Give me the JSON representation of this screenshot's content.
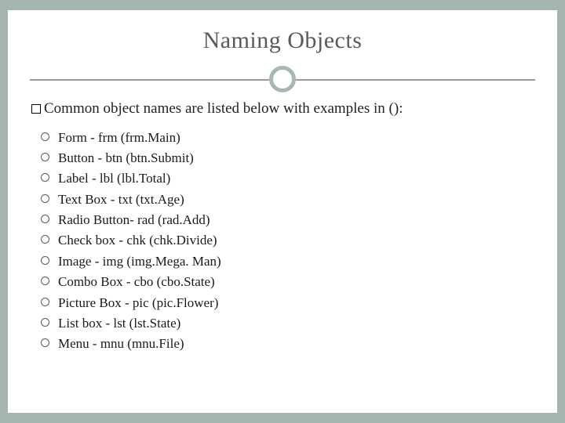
{
  "title": "Naming Objects",
  "intro_prefix": "Common object names are listed below with examples in ():",
  "items": [
    "Form - frm (frm.Main)",
    "Button - btn (btn.Submit)",
    "Label - lbl (lbl.Total)",
    "Text Box - txt (txt.Age)",
    "Radio Button-  rad (rad.Add)",
    "Check box - chk (chk.Divide)",
    "Image - img (img.Mega. Man)",
    "Combo Box - cbo (cbo.State)",
    "Picture Box - pic (pic.Flower)",
    "List box - lst (lst.State)",
    "Menu - mnu (mnu.File)"
  ]
}
